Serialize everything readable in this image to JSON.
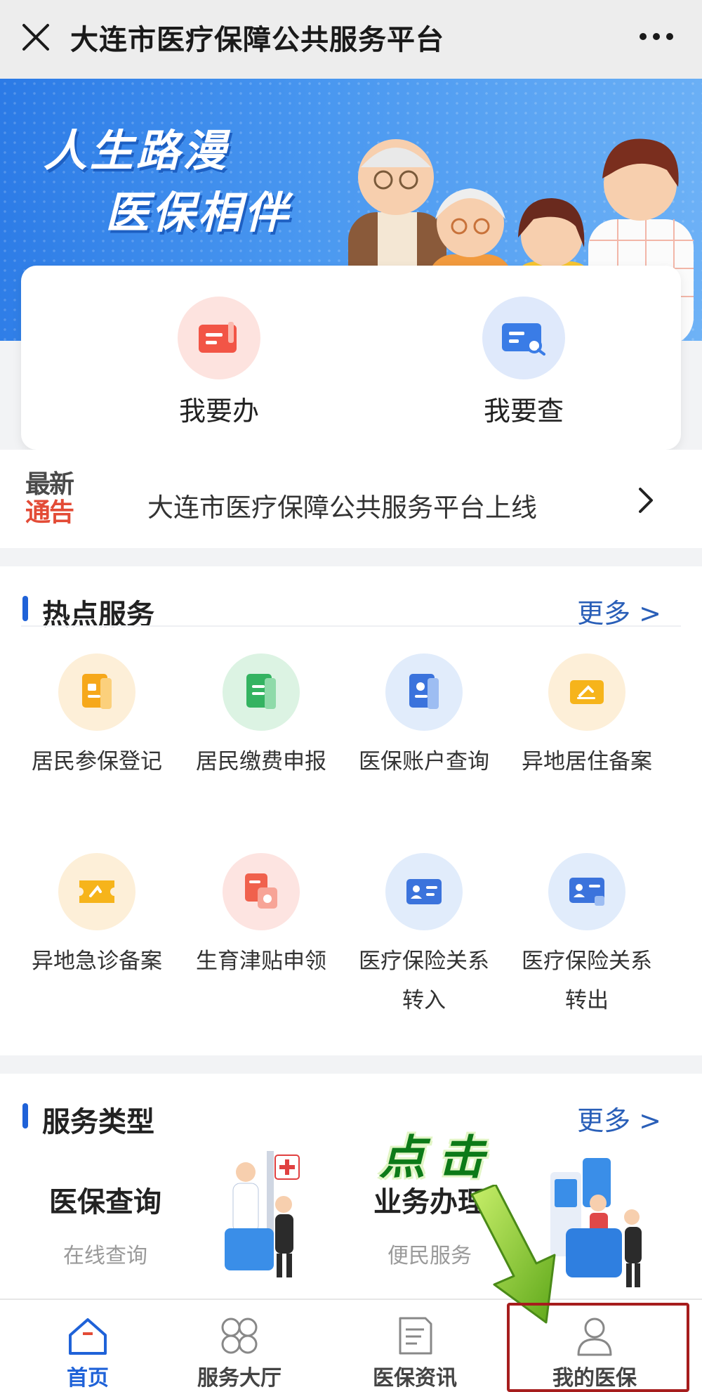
{
  "topbar": {
    "title": "大连市医疗保障公共服务平台"
  },
  "banner": {
    "line1": "人生路漫",
    "line2": "医保相伴"
  },
  "quick": {
    "items": [
      {
        "label": "我要办",
        "icon": "form-icon",
        "color": "#f25546"
      },
      {
        "label": "我要查",
        "icon": "search-card-icon",
        "color": "#3a7ce6"
      }
    ]
  },
  "notice": {
    "badge_line1": "最新",
    "badge_line2": "通告",
    "text": "大连市医疗保障公共服务平台上线"
  },
  "hot_services": {
    "title": "热点服务",
    "more": "更多 >",
    "items": [
      {
        "label": "居民参保登记",
        "icon": "register-icon",
        "bg": "#fdefd8",
        "fg": "#f6a81b"
      },
      {
        "label": "居民缴费申报",
        "icon": "payment-icon",
        "bg": "#dcf3e3",
        "fg": "#34b361"
      },
      {
        "label": "医保账户查询",
        "icon": "account-icon",
        "bg": "#e1ecfb",
        "fg": "#3b73dc"
      },
      {
        "label": "异地居住备案",
        "icon": "residence-icon",
        "bg": "#fdefd8",
        "fg": "#f6b41b"
      },
      {
        "label": "异地急诊备案",
        "icon": "emergency-ticket-icon",
        "bg": "#fdefd8",
        "fg": "#f6b41b"
      },
      {
        "label": "生育津贴申领",
        "icon": "maternity-icon",
        "bg": "#fde4e1",
        "fg": "#f0614d"
      },
      {
        "label": "医疗保险关系转入",
        "label_line1": "医疗保险关系",
        "label_line2": "转入",
        "icon": "transfer-in-icon",
        "bg": "#e1ecfb",
        "fg": "#3b73dc"
      },
      {
        "label": "医疗保险关系转出",
        "label_line1": "医疗保险关系",
        "label_line2": "转出",
        "icon": "transfer-out-icon",
        "bg": "#e1ecfb",
        "fg": "#3b73dc"
      }
    ]
  },
  "service_types": {
    "title": "服务类型",
    "more": "更多 >",
    "cards": [
      {
        "title": "医保查询",
        "subtitle": "在线查询"
      },
      {
        "title": "业务办理",
        "subtitle": "便民服务"
      }
    ],
    "annotation": "点击"
  },
  "tabbar": {
    "tabs": [
      {
        "label": "首页",
        "icon": "home-icon",
        "active": true
      },
      {
        "label": "服务大厅",
        "icon": "service-hall-icon",
        "active": false
      },
      {
        "label": "医保资讯",
        "icon": "news-icon",
        "active": false
      },
      {
        "label": "我的医保",
        "icon": "profile-icon",
        "active": false
      }
    ]
  },
  "colors": {
    "accent_blue": "#1f62d8",
    "highlight_red": "#a61d1d",
    "annotation_green": "#0c7a18"
  }
}
